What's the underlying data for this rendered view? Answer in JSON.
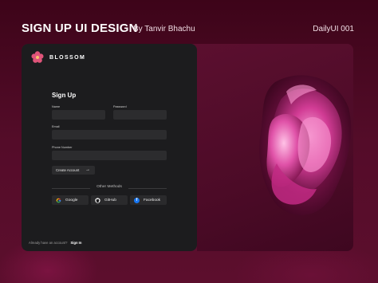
{
  "header": {
    "title": "SIGN UP UI DESIGN",
    "author": "By Tanvir Bhachu",
    "tag": "DailyUI 001"
  },
  "brand": {
    "name": "BLOSSOM",
    "logo_icon": "flower-icon",
    "logo_color": "#e0547a"
  },
  "form": {
    "title": "Sign Up",
    "name_label": "Name",
    "password_label": "Password",
    "email_label": "Email",
    "phone_label": "Phone Number",
    "create_button_label": "Create Account",
    "create_button_icon": "arrow-right-icon"
  },
  "other_methods": {
    "label": "Other Methods",
    "buttons": [
      {
        "label": "Google",
        "icon": "google-icon"
      },
      {
        "label": "GitHub",
        "icon": "github-icon"
      },
      {
        "label": "Facebook",
        "icon": "facebook-icon",
        "color": "#1877f2"
      }
    ]
  },
  "footer": {
    "text": "Already have an account?",
    "link": "Sign In"
  },
  "colors": {
    "accent": "#c21e6b",
    "panel_dark": "#1c1c1e",
    "field_bg": "#2c2c2e",
    "background": "#4a0a22"
  }
}
